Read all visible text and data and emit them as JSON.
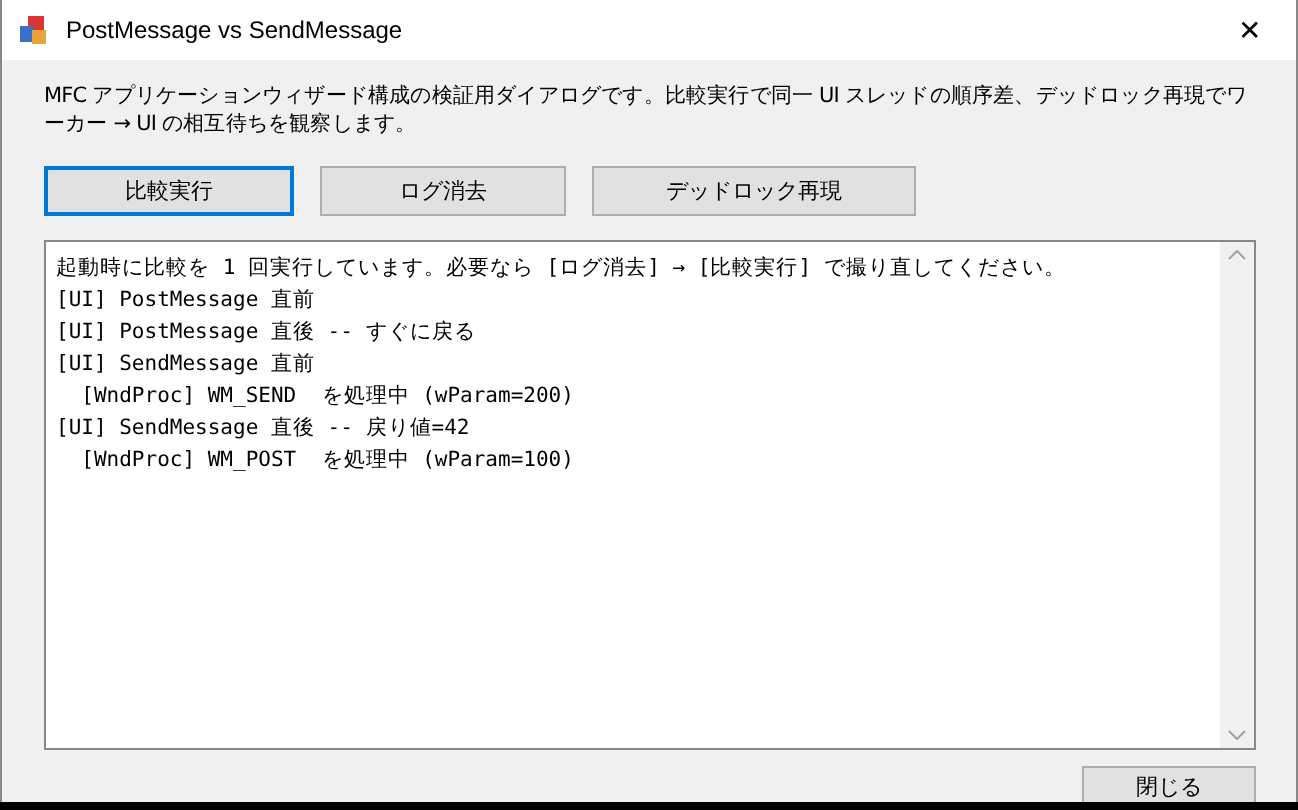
{
  "window": {
    "title": "PostMessage vs SendMessage",
    "close": "✕"
  },
  "description": "MFC アプリケーションウィザード構成の検証用ダイアログです。比較実行で同一 UI スレッドの順序差、デッドロック再現でワーカー → UI の相互待ちを観察します。",
  "buttons": [
    {
      "label": "比較実行",
      "focused": true
    },
    {
      "label": "ログ消去",
      "focused": false
    },
    {
      "label": "デッドロック再現",
      "focused": false
    }
  ],
  "log": {
    "lines": [
      "起動時に比較を 1 回実行しています。必要なら [ログ消去] → [比較実行] で撮り直してください。",
      "[UI] PostMessage 直前",
      "[UI] PostMessage 直後 -- すぐに戻る",
      "[UI] SendMessage 直前",
      "  [WndProc] WM_SEND  を処理中 (wParam=200)",
      "[UI] SendMessage 直後 -- 戻り値=42",
      "  [WndProc] WM_POST  を処理中 (wParam=100)"
    ]
  },
  "close_button": "閉じる"
}
